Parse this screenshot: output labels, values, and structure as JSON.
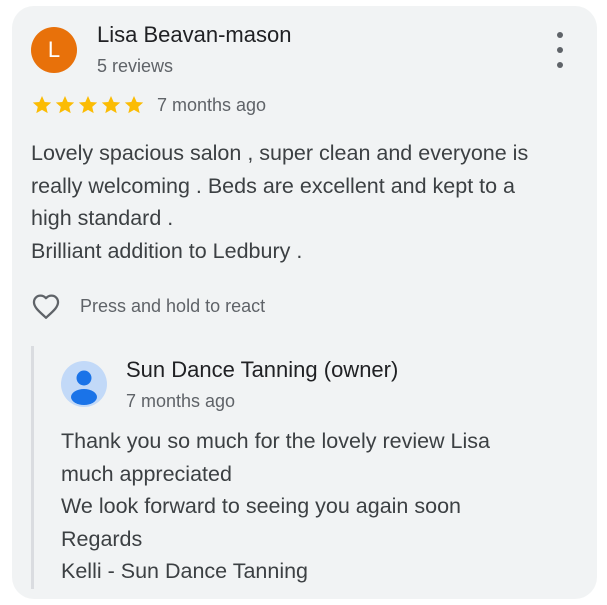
{
  "review": {
    "avatar_initial": "L",
    "avatar_color": "#e8710a",
    "reviewer_name": "Lisa Beavan-mason",
    "reviewer_meta": "5 reviews",
    "rating": 5,
    "max_rating": 5,
    "star_color": "#fbbc04",
    "date": "7 months ago",
    "text_lines": [
      "Lovely spacious salon , super clean and everyone is",
      "really welcoming . Beds are excellent and kept to a",
      "high standard .",
      "Brilliant addition to Ledbury ."
    ],
    "react_label": "Press and hold to react"
  },
  "owner_reply": {
    "name": "Sun Dance Tanning (owner)",
    "date": "7 months ago",
    "avatar_icon": "person-icon",
    "text_lines": [
      "Thank you so much for the lovely review Lisa",
      "much appreciated",
      "We look forward to seeing you again soon",
      "Regards",
      "Kelli - Sun Dance Tanning"
    ]
  },
  "icons": {
    "more": "more-vert-icon",
    "react": "heart-outline-icon",
    "star": "star-icon"
  }
}
